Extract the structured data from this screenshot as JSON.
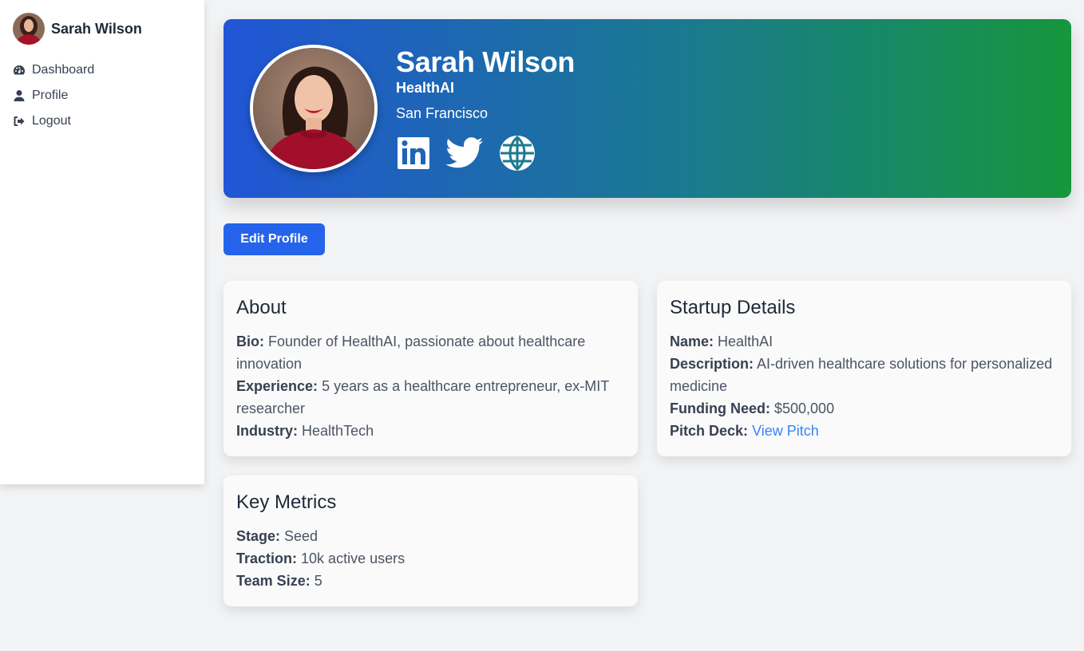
{
  "sidebar": {
    "user_name": "Sarah Wilson",
    "avatar_icon": "user-avatar",
    "items": [
      {
        "label": "Dashboard",
        "icon": "gauge-icon"
      },
      {
        "label": "Profile",
        "icon": "user-icon"
      },
      {
        "label": "Logout",
        "icon": "logout-icon"
      }
    ]
  },
  "profile": {
    "name": "Sarah Wilson",
    "company": "HealthAI",
    "location": "San Francisco",
    "social": [
      {
        "icon": "linkedin-icon"
      },
      {
        "icon": "twitter-icon"
      },
      {
        "icon": "globe-icon"
      }
    ],
    "gradient_colors": [
      "#2155d6",
      "#16963d"
    ]
  },
  "actions": {
    "edit_label": "Edit Profile",
    "edit_color": "#2563eb"
  },
  "about": {
    "title": "About",
    "bio_label": "Bio:",
    "bio_value": "Founder of HealthAI, passionate about healthcare innovation",
    "experience_label": "Experience:",
    "experience_value": "5 years as a healthcare entrepreneur, ex-MIT researcher",
    "industry_label": "Industry:",
    "industry_value": "HealthTech"
  },
  "startup": {
    "title": "Startup Details",
    "name_label": "Name:",
    "name_value": "HealthAI",
    "description_label": "Description:",
    "description_value": "AI-driven healthcare solutions for personalized medicine",
    "funding_label": "Funding Need:",
    "funding_value": "$500,000",
    "pitch_label": "Pitch Deck:",
    "pitch_link": "View Pitch"
  },
  "metrics": {
    "title": "Key Metrics",
    "stage_label": "Stage:",
    "stage_value": "Seed",
    "traction_label": "Traction:",
    "traction_value": "10k active users",
    "team_label": "Team Size:",
    "team_value": "5"
  }
}
